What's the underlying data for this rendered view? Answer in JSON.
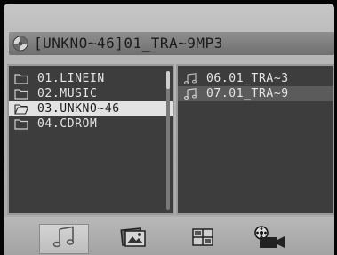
{
  "header": {
    "title": "[UNKNO~46]01_TRA~9MP3",
    "icon": "disc-icon"
  },
  "folders": {
    "items": [
      {
        "label": "01.LINEIN",
        "icon": "folder-icon",
        "selected": false
      },
      {
        "label": "02.MUSIC",
        "icon": "folder-icon",
        "selected": false
      },
      {
        "label": "03.UNKNO~46",
        "icon": "folder-open-icon",
        "selected": true
      },
      {
        "label": "04.CDROM",
        "icon": "folder-icon",
        "selected": false
      }
    ]
  },
  "files": {
    "items": [
      {
        "label": "06.01_TRA~3",
        "icon": "music-note-icon",
        "highlight": false
      },
      {
        "label": "07.01_TRA~9",
        "icon": "music-note-icon",
        "highlight": true
      }
    ]
  },
  "bottom_bar": {
    "buttons": [
      {
        "name": "music",
        "icon": "music-note-icon",
        "active": true
      },
      {
        "name": "photo",
        "icon": "photo-icon",
        "active": false
      },
      {
        "name": "ebook",
        "icon": "grid-icon",
        "active": false
      },
      {
        "name": "movie",
        "icon": "film-camera-icon",
        "active": false
      }
    ]
  },
  "colors": {
    "panel_bg": "#3d3d3d",
    "selection_bg": "#e2e2e2",
    "frame_bg": "#b5b5b5"
  }
}
